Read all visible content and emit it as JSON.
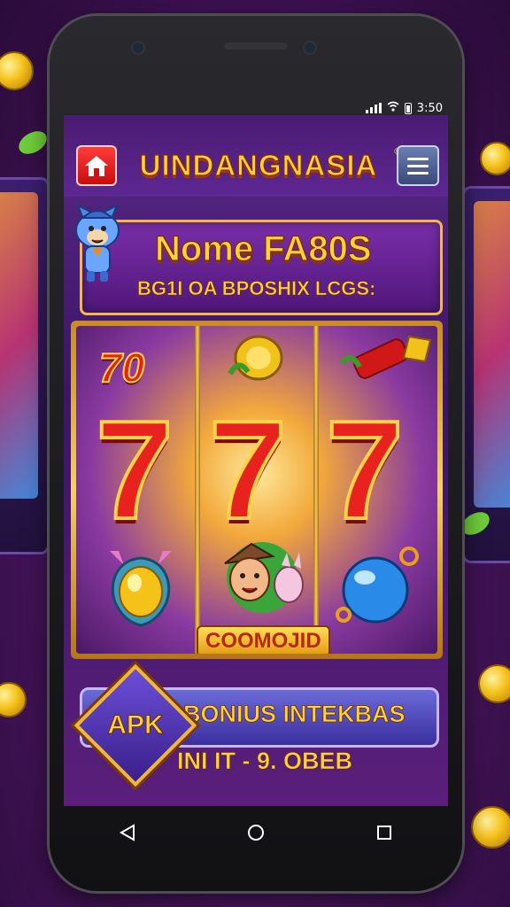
{
  "status_bar": {
    "time": "3:50",
    "signal_icon": "signal-icon",
    "wifi_icon": "wifi-icon",
    "battery_icon": "battery-icon"
  },
  "header": {
    "title": "UINDANGNASIA",
    "registered_mark": "®",
    "home_icon": "home-icon",
    "menu_icon": "hamburger-menu-icon"
  },
  "promo": {
    "title": "Nome FA80S",
    "subtitle": "BG1I OA BPOSHIX LCGS:"
  },
  "slot": {
    "top_left_symbol": "70",
    "center_symbols": [
      "7",
      "7",
      "7"
    ],
    "label": "COOMOJID"
  },
  "bonus": {
    "apk_label": "APK",
    "button_label": "BONIUS INTEKBAS",
    "sub_text": "INI IT - 9. OBEB"
  },
  "nav": {
    "back_icon": "back-triangle-icon",
    "home_icon": "home-circle-icon",
    "recents_icon": "recents-square-icon"
  },
  "colors": {
    "accent": "#ffd23a",
    "background": "#4a1660",
    "seven_red": "#e8231f"
  }
}
